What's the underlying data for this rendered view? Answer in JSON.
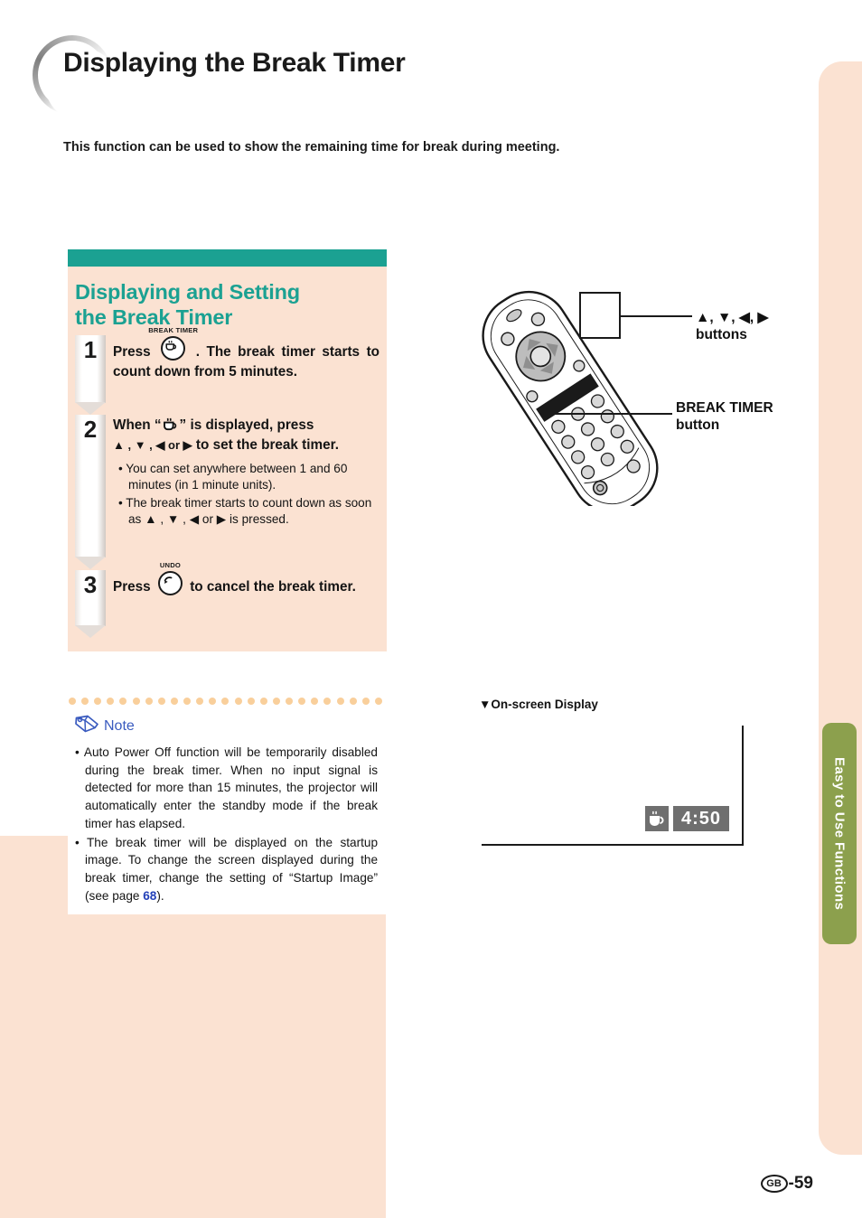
{
  "page": {
    "title": "Displaying the Break Timer",
    "intro": "This function can be used to show the remaining time for break during meeting.",
    "footer_region": "GB",
    "footer_page": "-59",
    "side_tab": "Easy to Use Functions"
  },
  "colors": {
    "teal": "#1ba192",
    "peach": "#fbe2d2",
    "note_blue": "#3a5bbf",
    "link_blue": "#2340b8",
    "tab_green": "#8ca04d",
    "osd_gray": "#6f6f6f"
  },
  "panel": {
    "heading_line1": "Displaying and Setting",
    "heading_line2": "the Break Timer",
    "steps": [
      {
        "number": "1",
        "button_caption": "BREAK TIMER",
        "button_icon": "coffee-cup-icon",
        "text_before": "Press",
        "text_after": ". The break timer starts to count down from 5 minutes.",
        "bullets": []
      },
      {
        "number": "2",
        "text_before": "When “",
        "text_mid": "” is displayed, press",
        "arrows": "▲ , ▼ , ◀ or ▶",
        "text_after": "to set the break timer.",
        "bullets": [
          "You can set anywhere between 1 and 60 minutes (in 1 minute units).",
          "The break timer starts to count down as soon as ▲ , ▼ , ◀ or ▶ is pressed."
        ]
      },
      {
        "number": "3",
        "button_caption": "UNDO",
        "button_icon": "undo-arrow-icon",
        "text_before": "Press",
        "text_after": "to cancel the break timer.",
        "bullets": []
      }
    ]
  },
  "note": {
    "label": "Note",
    "icon": "pencil-icon",
    "items": [
      {
        "text_a": "Auto Power Off function will be temporarily disabled during the break timer. When no  input signal is detected for more than 15 minutes, the projector will automatically enter the standby mode if the break timer has elapsed."
      },
      {
        "text_a": "The break timer will be displayed on the startup image. To change the screen displayed during the break timer, change the setting of “Startup Image” (see page ",
        "link": "68",
        "text_b": ")."
      }
    ]
  },
  "illustration": {
    "device": "remote-control",
    "callouts": [
      {
        "line1": "▲, ▼, ◀, ▶",
        "line2": "buttons"
      },
      {
        "line1": "BREAK TIMER",
        "line2": "button"
      }
    ]
  },
  "osd": {
    "title": "▼On-screen Display",
    "icon": "coffee-cup-icon",
    "time": "4:50"
  }
}
